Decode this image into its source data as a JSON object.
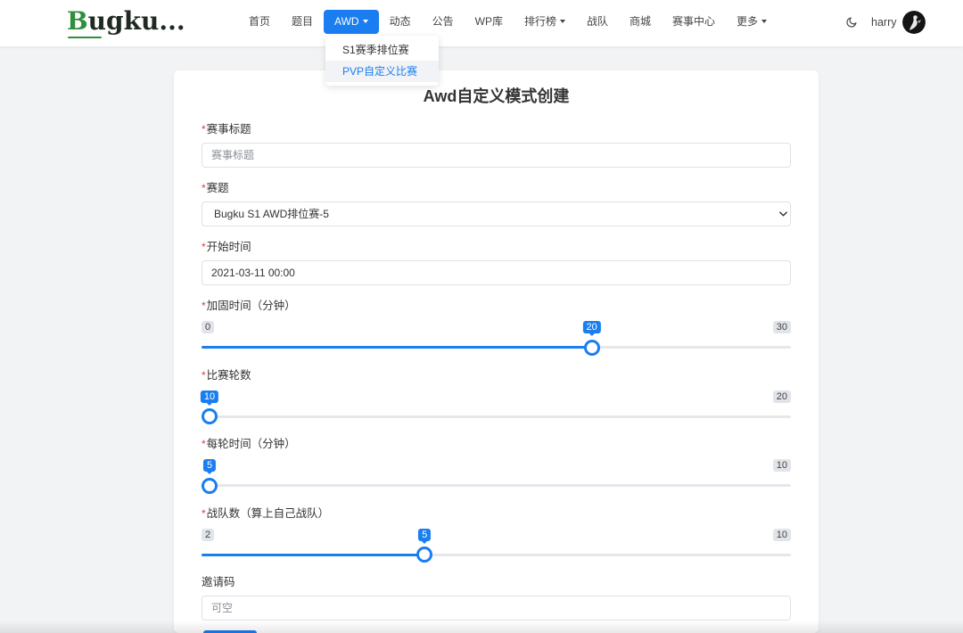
{
  "logo": {
    "first": "B",
    "rest": "ugku..."
  },
  "nav": {
    "items": [
      {
        "label": "首页"
      },
      {
        "label": "题目"
      },
      {
        "label": "AWD",
        "has_menu": true,
        "active": true
      },
      {
        "label": "动态"
      },
      {
        "label": "公告"
      },
      {
        "label": "WP库"
      },
      {
        "label": "排行榜",
        "has_menu": true
      },
      {
        "label": "战队"
      },
      {
        "label": "商城"
      },
      {
        "label": "赛事中心"
      },
      {
        "label": "更多",
        "has_menu": true
      }
    ],
    "awd_menu": {
      "items": [
        {
          "label": "S1赛季排位赛"
        },
        {
          "label": "PVP自定义比赛",
          "hovered": true
        }
      ]
    }
  },
  "user": {
    "name": "harry",
    "theme_toggle_icon": "moon-icon",
    "avatar_icon": "avatar"
  },
  "form": {
    "title": "Awd自定义模式创建",
    "required_mark": "*",
    "fields": {
      "event_title": {
        "label": "赛事标题",
        "placeholder": "赛事标题"
      },
      "challenge": {
        "label": "赛题",
        "value": "Bugku S1 AWD排位赛-5"
      },
      "start_time": {
        "label": "开始时间",
        "value": "2021-03-11 00:00"
      },
      "invite_code": {
        "label": "邀请码",
        "placeholder": "可空"
      }
    },
    "sliders": [
      {
        "label": "加固时间（分钟）",
        "min": 0,
        "max": 30,
        "value": 20
      },
      {
        "label": "比赛轮数",
        "min": 10,
        "max": 20,
        "value": 10
      },
      {
        "label": "每轮时间（分钟）",
        "min": 5,
        "max": 10,
        "value": 5
      },
      {
        "label": "战队数（算上自己战队）",
        "min": 2,
        "max": 10,
        "value": 5
      }
    ]
  },
  "colors": {
    "accent": "#1a7ef0",
    "required": "#e5393e",
    "page_bg": "#f2f3f5"
  }
}
